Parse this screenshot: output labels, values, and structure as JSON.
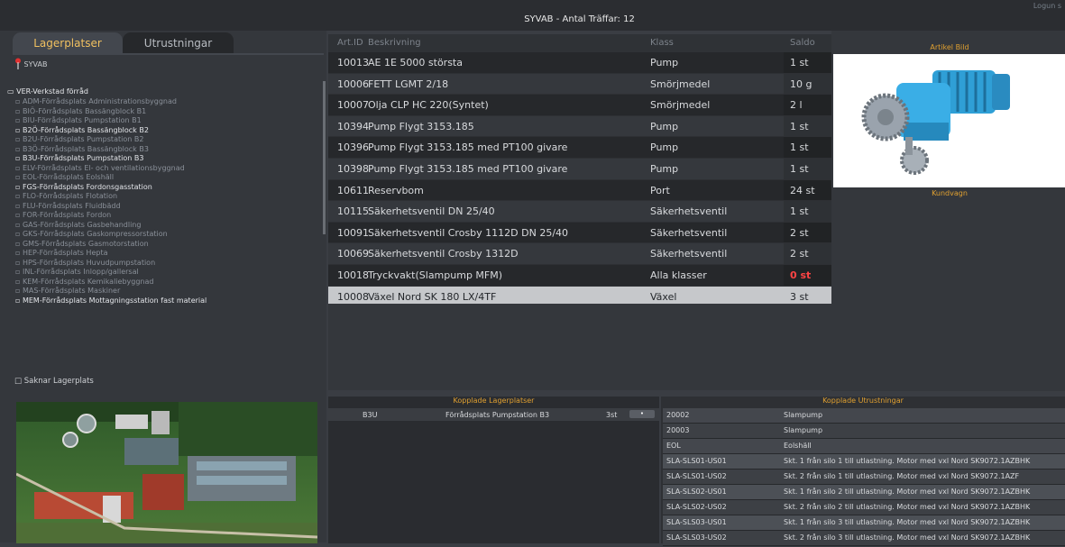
{
  "header": {
    "title": "SYVAB  -  Antal Träffar: 12",
    "logout": "Logun s"
  },
  "tabs": [
    {
      "label": "Lagerplatser"
    },
    {
      "label": "Utrustningar"
    }
  ],
  "location_filter": "SYVAB",
  "tree": {
    "root": "VER-Verkstad förråd",
    "items": [
      {
        "label": "ADM-Förrådsplats Administrationsbyggnad",
        "hi": false
      },
      {
        "label": "BIÖ-Förrådsplats Bassängblock B1",
        "hi": false
      },
      {
        "label": "BIU-Förrådsplats Pumpstation B1",
        "hi": false
      },
      {
        "label": "B2Ö-Förrådsplats Bassängblock B2",
        "hi": true
      },
      {
        "label": "B2U-Förrådsplats Pumpstation B2",
        "hi": false
      },
      {
        "label": "B3Ö-Förrådsplats Bassängblock B3",
        "hi": false
      },
      {
        "label": "B3U-Förrådsplats Pumpstation B3",
        "hi": true
      },
      {
        "label": "ELV-Förrådsplats El- och ventilationsbyggnad",
        "hi": false
      },
      {
        "label": "EOL-Förrådsplats Eolshäll",
        "hi": false
      },
      {
        "label": "FGS-Förrådsplats Fordonsgasstation",
        "hi": true
      },
      {
        "label": "FLO-Förrådsplats Flotation",
        "hi": false
      },
      {
        "label": "FLU-Förrådsplats Fluidbädd",
        "hi": false
      },
      {
        "label": "FOR-Förrådsplats Fordon",
        "hi": false
      },
      {
        "label": "GAS-Förrådsplats Gasbehandling",
        "hi": false
      },
      {
        "label": "GKS-Förrådsplats Gaskompressorstation",
        "hi": false
      },
      {
        "label": "GMS-Förrådsplats Gasmotorstation",
        "hi": false
      },
      {
        "label": "HEP-Förrådsplats Hepta",
        "hi": false
      },
      {
        "label": "HPS-Förrådsplats Huvudpumpstation",
        "hi": false
      },
      {
        "label": "INL-Förrådsplats Inlopp/gallersal",
        "hi": false
      },
      {
        "label": "KEM-Förrådsplats Kemikaliebyggnad",
        "hi": false
      },
      {
        "label": "MAS-Förrådsplats Maskiner",
        "hi": false
      },
      {
        "label": "MEM-Förrådsplats Mottagningsstation fast material",
        "hi": true
      }
    ],
    "missing_label": "Saknar Lagerplats"
  },
  "table": {
    "headers": {
      "id": "Art.ID",
      "desc": "Beskrivning",
      "class": "Klass",
      "saldo": "Saldo"
    },
    "rows": [
      {
        "id": "10013",
        "desc": "AE 1E 5000 största",
        "class": "Pump",
        "saldo": "1 st",
        "style": "dark"
      },
      {
        "id": "10006",
        "desc": "FETT LGMT 2/18",
        "class": "Smörjmedel",
        "saldo": "10 g",
        "style": "mid"
      },
      {
        "id": "10007",
        "desc": "Olja CLP HC 220(Syntet)",
        "class": "Smörjmedel",
        "saldo": "2 l",
        "style": "dark"
      },
      {
        "id": "10394",
        "desc": "Pump Flygt 3153.185",
        "class": "Pump",
        "saldo": "1 st",
        "style": "mid"
      },
      {
        "id": "10396",
        "desc": "Pump Flygt 3153.185 med PT100 givare",
        "class": "Pump",
        "saldo": "1 st",
        "style": "dark"
      },
      {
        "id": "10398",
        "desc": "Pump Flygt 3153.185 med PT100 givare",
        "class": "Pump",
        "saldo": "1 st",
        "style": "mid"
      },
      {
        "id": "10611",
        "desc": "Reservbom",
        "class": "Port",
        "saldo": "24 st",
        "style": "dark"
      },
      {
        "id": "10115",
        "desc": "Säkerhetsventil DN 25/40",
        "class": "Säkerhetsventil",
        "saldo": "1 st",
        "style": "mid"
      },
      {
        "id": "10091",
        "desc": "Säkerhetsventil Crosby 1112D DN 25/40",
        "class": "Säkerhetsventil",
        "saldo": "2 st",
        "style": "dark"
      },
      {
        "id": "10069",
        "desc": "Säkerhetsventil Crosby 1312D",
        "class": "Säkerhetsventil",
        "saldo": "2 st",
        "style": "mid"
      },
      {
        "id": "10018",
        "desc": "Tryckvakt(Slampump MFM)",
        "class": "Alla klasser",
        "saldo": "0 st",
        "style": "dark",
        "alert": true
      },
      {
        "id": "10008",
        "desc": "Växel Nord SK 180 LX/4TF",
        "class": "Växel",
        "saldo": "3 st",
        "style": "sel"
      }
    ]
  },
  "right": {
    "article_image_label": "Artikel Bild",
    "cart_label": "Kundvagn"
  },
  "linked_locations": {
    "title": "Kopplade Lagerplatser",
    "rows": [
      {
        "code": "B3U",
        "name": "Förrådsplats Pumpstation B3",
        "qty": "3st"
      }
    ]
  },
  "linked_equipment": {
    "title": "Kopplade Utrustningar",
    "rows": [
      {
        "id": "20002",
        "desc": "Slampump",
        "style": "a"
      },
      {
        "id": "20003",
        "desc": "Slampump",
        "style": "b"
      },
      {
        "id": "EOL",
        "desc": "Eolshäll",
        "style": "a"
      },
      {
        "id": "SLA-SLS01-US01",
        "desc": "Skt. 1 från silo 1 till utlastning. Motor med vxl Nord SK9072.1AZBHK",
        "style": "c"
      },
      {
        "id": "SLA-SLS01-US02",
        "desc": "Skt. 2 från silo 1 till utlastning. Motor med vxl Nord SK9072.1AZF",
        "style": "b"
      },
      {
        "id": "SLA-SLS02-US01",
        "desc": "Skt. 1 från silo 2 till utlastning. Motor med vxl Nord SK9072.1AZBHK",
        "style": "c"
      },
      {
        "id": "SLA-SLS02-US02",
        "desc": "Skt. 2 från silo 2 till utlastning. Motor med vxl Nord SK9072.1AZBHK",
        "style": "b"
      },
      {
        "id": "SLA-SLS03-US01",
        "desc": "Skt. 1 från silo 3 till utlastning. Motor med vxl Nord SK9072.1AZBHK",
        "style": "c"
      },
      {
        "id": "SLA-SLS03-US02",
        "desc": "Skt. 2 från silo 3 till utlastning. Motor med vxl Nord SK9072.1AZBHK",
        "style": "b"
      }
    ]
  }
}
